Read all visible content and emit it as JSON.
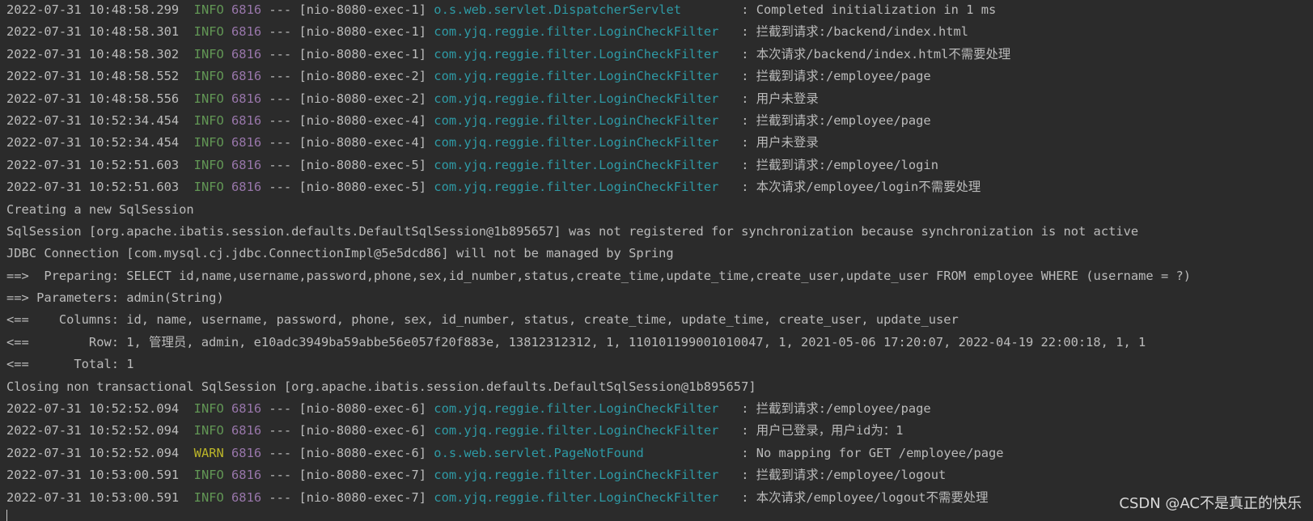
{
  "colors": {
    "background": "#2b2b2b",
    "text": "#bbbbbb",
    "info": "#629755",
    "warn": "#bbb529",
    "pid": "#9876aa",
    "logger": "#2e9aa5"
  },
  "log_lines": [
    {
      "ts": "2022-07-31 10:48:58.299",
      "level": "INFO",
      "pid": "6816",
      "sep": "---",
      "thread": "[nio-8080-exec-1]",
      "logger": "o.s.web.servlet.DispatcherServlet",
      "msg": "Completed initialization in 1 ms"
    },
    {
      "ts": "2022-07-31 10:48:58.301",
      "level": "INFO",
      "pid": "6816",
      "sep": "---",
      "thread": "[nio-8080-exec-1]",
      "logger": "com.yjq.reggie.filter.LoginCheckFilter",
      "msg": "拦截到请求:/backend/index.html"
    },
    {
      "ts": "2022-07-31 10:48:58.302",
      "level": "INFO",
      "pid": "6816",
      "sep": "---",
      "thread": "[nio-8080-exec-1]",
      "logger": "com.yjq.reggie.filter.LoginCheckFilter",
      "msg": "本次请求/backend/index.html不需要处理"
    },
    {
      "ts": "2022-07-31 10:48:58.552",
      "level": "INFO",
      "pid": "6816",
      "sep": "---",
      "thread": "[nio-8080-exec-2]",
      "logger": "com.yjq.reggie.filter.LoginCheckFilter",
      "msg": "拦截到请求:/employee/page"
    },
    {
      "ts": "2022-07-31 10:48:58.556",
      "level": "INFO",
      "pid": "6816",
      "sep": "---",
      "thread": "[nio-8080-exec-2]",
      "logger": "com.yjq.reggie.filter.LoginCheckFilter",
      "msg": "用户未登录"
    },
    {
      "ts": "2022-07-31 10:52:34.454",
      "level": "INFO",
      "pid": "6816",
      "sep": "---",
      "thread": "[nio-8080-exec-4]",
      "logger": "com.yjq.reggie.filter.LoginCheckFilter",
      "msg": "拦截到请求:/employee/page"
    },
    {
      "ts": "2022-07-31 10:52:34.454",
      "level": "INFO",
      "pid": "6816",
      "sep": "---",
      "thread": "[nio-8080-exec-4]",
      "logger": "com.yjq.reggie.filter.LoginCheckFilter",
      "msg": "用户未登录"
    },
    {
      "ts": "2022-07-31 10:52:51.603",
      "level": "INFO",
      "pid": "6816",
      "sep": "---",
      "thread": "[nio-8080-exec-5]",
      "logger": "com.yjq.reggie.filter.LoginCheckFilter",
      "msg": "拦截到请求:/employee/login"
    },
    {
      "ts": "2022-07-31 10:52:51.603",
      "level": "INFO",
      "pid": "6816",
      "sep": "---",
      "thread": "[nio-8080-exec-5]",
      "logger": "com.yjq.reggie.filter.LoginCheckFilter",
      "msg": "本次请求/employee/login不需要处理"
    },
    {
      "plain": "Creating a new SqlSession"
    },
    {
      "plain": "SqlSession [org.apache.ibatis.session.defaults.DefaultSqlSession@1b895657] was not registered for synchronization because synchronization is not active"
    },
    {
      "plain": "JDBC Connection [com.mysql.cj.jdbc.ConnectionImpl@5e5dcd86] will not be managed by Spring"
    },
    {
      "plain": "==>  Preparing: SELECT id,name,username,password,phone,sex,id_number,status,create_time,update_time,create_user,update_user FROM employee WHERE (username = ?)"
    },
    {
      "plain": "==> Parameters: admin(String)"
    },
    {
      "plain": "<==    Columns: id, name, username, password, phone, sex, id_number, status, create_time, update_time, create_user, update_user"
    },
    {
      "plain": "<==        Row: 1, 管理员, admin, e10adc3949ba59abbe56e057f20f883e, 13812312312, 1, 110101199001010047, 1, 2021-05-06 17:20:07, 2022-04-19 22:00:18, 1, 1"
    },
    {
      "plain": "<==      Total: 1"
    },
    {
      "plain": "Closing non transactional SqlSession [org.apache.ibatis.session.defaults.DefaultSqlSession@1b895657]"
    },
    {
      "ts": "2022-07-31 10:52:52.094",
      "level": "INFO",
      "pid": "6816",
      "sep": "---",
      "thread": "[nio-8080-exec-6]",
      "logger": "com.yjq.reggie.filter.LoginCheckFilter",
      "msg": "拦截到请求:/employee/page"
    },
    {
      "ts": "2022-07-31 10:52:52.094",
      "level": "INFO",
      "pid": "6816",
      "sep": "---",
      "thread": "[nio-8080-exec-6]",
      "logger": "com.yjq.reggie.filter.LoginCheckFilter",
      "msg": "用户已登录，用户id为：1"
    },
    {
      "ts": "2022-07-31 10:52:52.094",
      "level": "WARN",
      "pid": "6816",
      "sep": "---",
      "thread": "[nio-8080-exec-6]",
      "logger": "o.s.web.servlet.PageNotFound",
      "msg": "No mapping for GET /employee/page"
    },
    {
      "ts": "2022-07-31 10:53:00.591",
      "level": "INFO",
      "pid": "6816",
      "sep": "---",
      "thread": "[nio-8080-exec-7]",
      "logger": "com.yjq.reggie.filter.LoginCheckFilter",
      "msg": "拦截到请求:/employee/logout"
    },
    {
      "ts": "2022-07-31 10:53:00.591",
      "level": "INFO",
      "pid": "6816",
      "sep": "---",
      "thread": "[nio-8080-exec-7]",
      "logger": "com.yjq.reggie.filter.LoginCheckFilter",
      "msg": "本次请求/employee/logout不需要处理"
    }
  ],
  "watermark": "CSDN @AC不是真正的快乐"
}
